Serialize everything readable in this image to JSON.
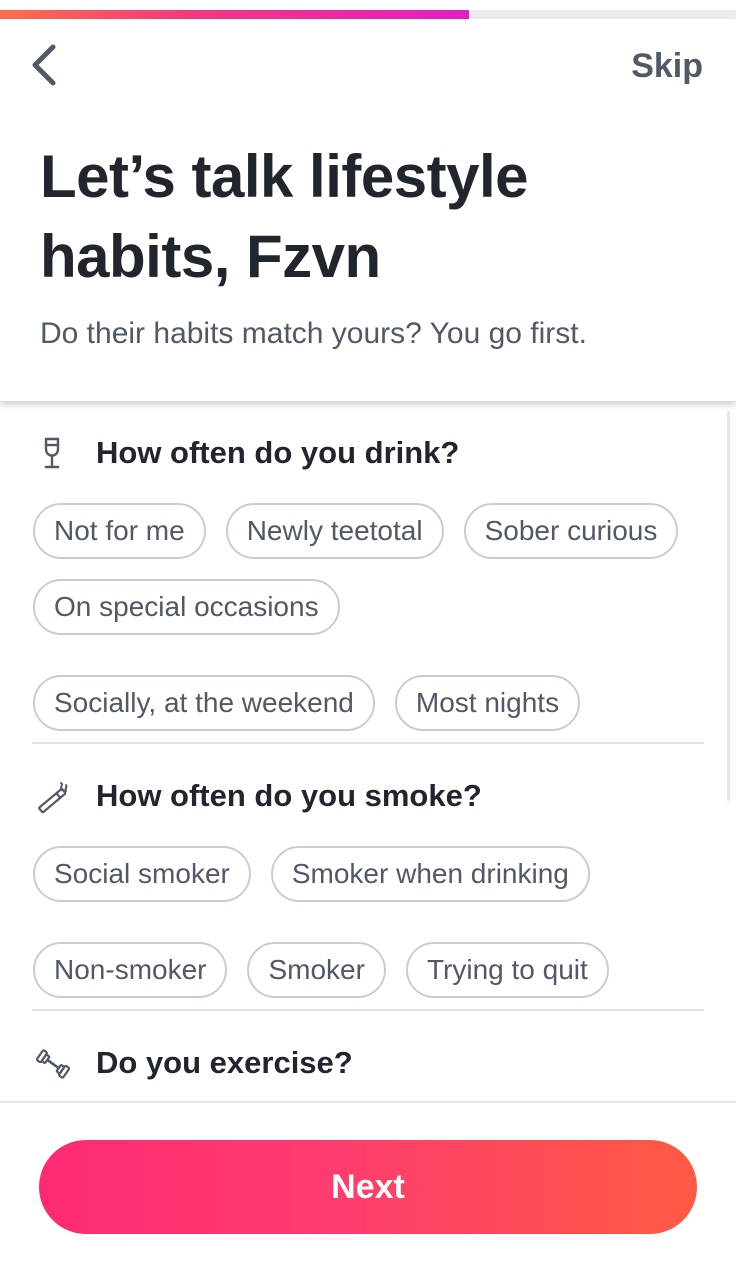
{
  "progress": {
    "fraction": 0.637
  },
  "header": {
    "back_icon": "chevron-left-icon",
    "skip_label": "Skip",
    "title": "Let’s talk lifestyle habits, Fzvn",
    "subtitle": "Do their habits match yours? You go first."
  },
  "sections": {
    "drink": {
      "icon": "wine-glass-icon",
      "question": "How often do you drink?",
      "options": [
        "Not for me",
        "Newly teetotal",
        "Sober curious",
        "On special occasions",
        "Socially, at the weekend",
        "Most nights"
      ]
    },
    "smoke": {
      "icon": "cigarette-icon",
      "question": "How often do you smoke?",
      "options": [
        "Social smoker",
        "Smoker when drinking",
        "Non-smoker",
        "Smoker",
        "Trying to quit"
      ]
    },
    "exercise": {
      "icon": "dumbbell-icon",
      "question": "Do you exercise?"
    }
  },
  "footer": {
    "next_label": "Next"
  },
  "colors": {
    "progress_start": "#fd6f4a",
    "progress_end": "#e01fc4",
    "button_start": "#fd2a73",
    "button_end": "#ff5a43",
    "chip_border": "#c9cdd3",
    "text_primary": "#21262e",
    "text_secondary": "#505965"
  }
}
